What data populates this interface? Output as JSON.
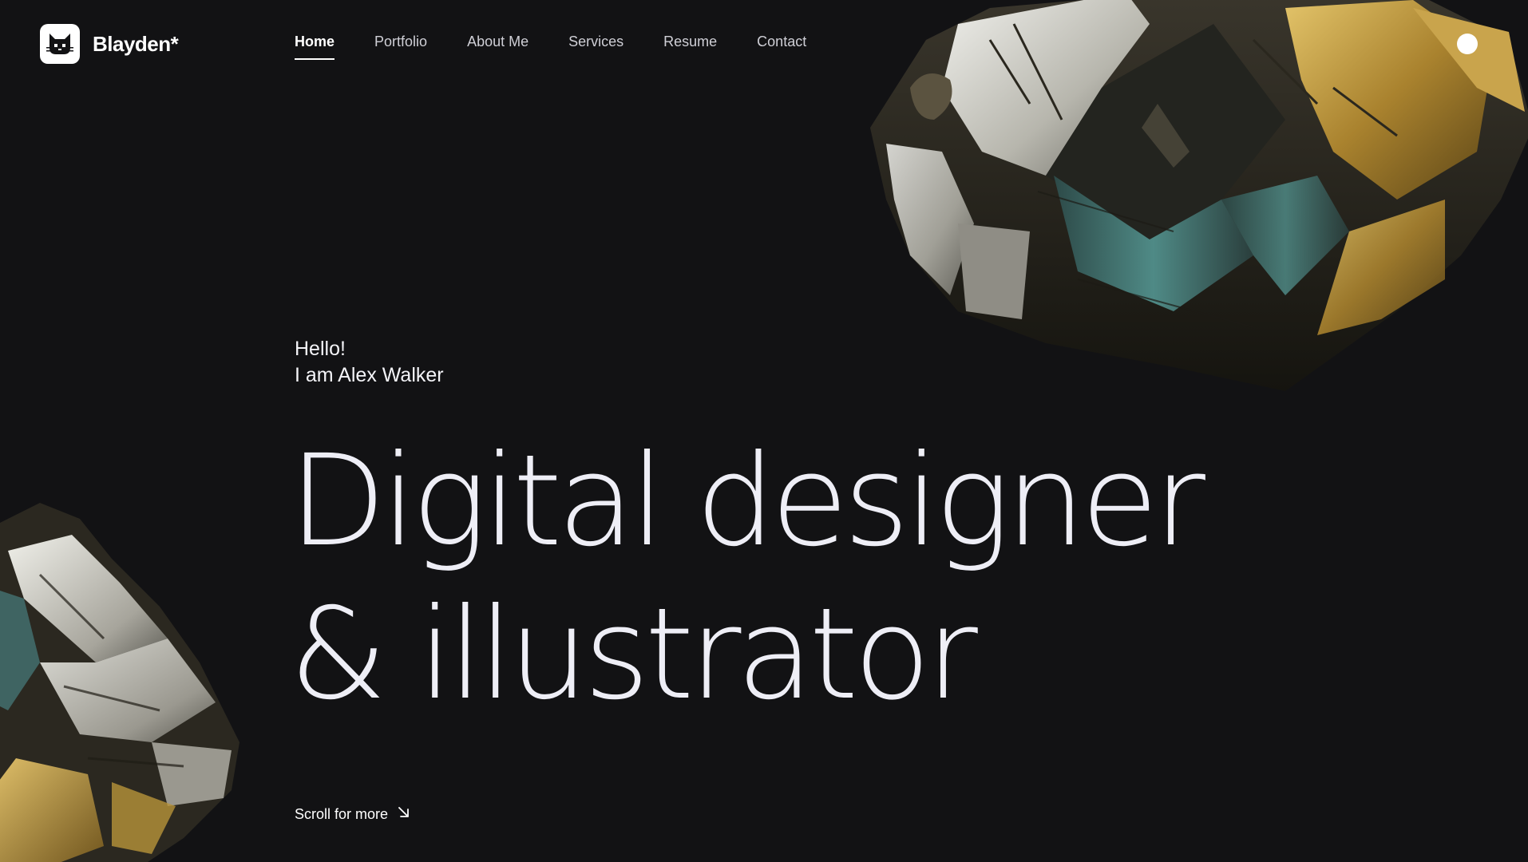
{
  "brand": {
    "name": "Blayden*",
    "logo_icon": "cat-icon"
  },
  "nav": {
    "items": [
      {
        "label": "Home",
        "active": true
      },
      {
        "label": "Portfolio",
        "active": false
      },
      {
        "label": "About Me",
        "active": false
      },
      {
        "label": "Services",
        "active": false
      },
      {
        "label": "Resume",
        "active": false
      },
      {
        "label": "Contact",
        "active": false
      }
    ]
  },
  "hero": {
    "greeting_line1": "Hello!",
    "greeting_line2": "I am Alex Walker",
    "headline_line1": "Digital designer",
    "headline_line2": "& illustrator",
    "scroll_label": "Scroll for more",
    "scroll_icon": "arrow-down-right-icon"
  },
  "theme_toggle": {
    "icon": "circle-icon"
  },
  "colors": {
    "background": "#121214",
    "text": "#eeeef6",
    "accent": "#ffffff",
    "rock_gold": "#b8933a",
    "rock_teal": "#3c6a6a"
  }
}
